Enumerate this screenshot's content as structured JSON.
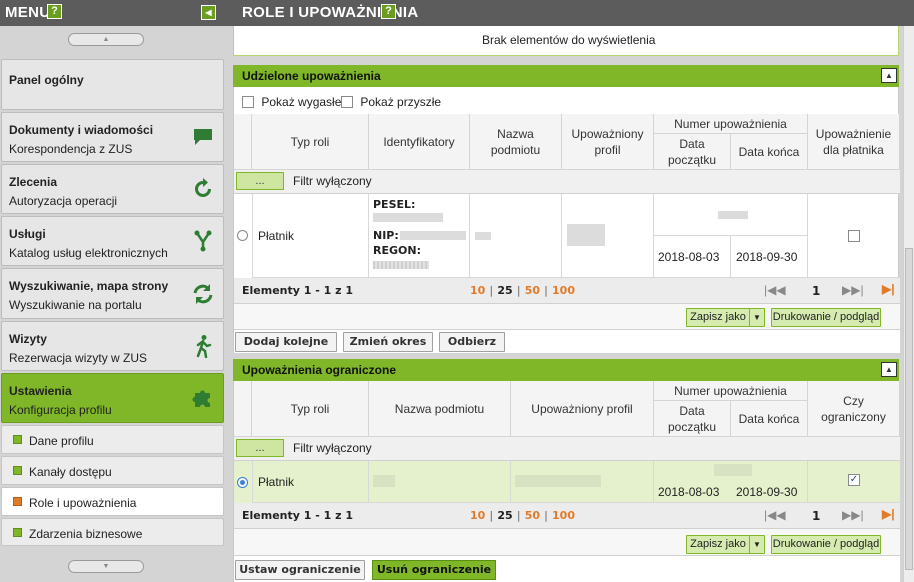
{
  "sidebar": {
    "menu_label": "MENU",
    "help_icon": "question-mark-icon",
    "collapse_icon": "arrow-left-icon",
    "scroll_up_glyph": "▲",
    "scroll_down_glyph": "▼",
    "items": [
      {
        "title": "Panel ogólny",
        "subtitle": "",
        "icon": ""
      },
      {
        "title": "Dokumenty i wiadomości",
        "subtitle": "Korespondencja z ZUS",
        "icon": "speech-bubble-icon"
      },
      {
        "title": "Zlecenia",
        "subtitle": "Autoryzacja operacji",
        "icon": "refresh-arrow-icon"
      },
      {
        "title": "Usługi",
        "subtitle": "Katalog usług elektronicznych",
        "icon": "network-nodes-icon"
      },
      {
        "title": "Wyszukiwanie, mapa strony",
        "subtitle": "Wyszukiwanie na portalu",
        "icon": "sync-arrows-icon"
      },
      {
        "title": "Wizyty",
        "subtitle": "Rezerwacja wizyty w ZUS",
        "icon": "walking-person-icon"
      },
      {
        "title": "Ustawienia",
        "subtitle": "Konfiguracja profilu",
        "icon": "puzzle-icon"
      }
    ],
    "sub_items": [
      {
        "label": "Dane profilu"
      },
      {
        "label": "Kanały dostępu"
      },
      {
        "label": "Role i upoważnienia"
      },
      {
        "label": "Zdarzenia biznesowe"
      }
    ]
  },
  "main": {
    "title": "ROLE I UPOWAŻNIENIA",
    "empty_message": "Brak elementów do wyświetlenia",
    "granted": {
      "title": "Udzielone upoważnienia",
      "toggle_glyph": "▲",
      "show_expired": "Pokaż wygasłe",
      "show_future": "Pokaż przyszłe",
      "headers": {
        "role_type": "Typ roli",
        "identifiers": "Identyfikatory",
        "entity_name": "Nazwa podmiotu",
        "authorized_profile": "Upoważniony profil",
        "number": "Numer upoważnienia",
        "start_date": "Data początku",
        "end_date": "Data końca",
        "payer_auth": "Upoważnienie dla płatnika"
      },
      "filter_button": "...",
      "filter_label": "Filtr wyłączony",
      "row": {
        "role": "Płatnik",
        "pesel_label": "PESEL:",
        "nip_label": "NIP:",
        "regon_label": "REGON:",
        "start": "2018-08-03",
        "end": "2018-09-30"
      },
      "pager": {
        "count": "Elementy 1 - 1 z 1",
        "sizes": [
          "10",
          "25",
          "50",
          "100"
        ],
        "page": "1"
      },
      "save_as": "Zapisz jako",
      "print": "Drukowanie / podgląd",
      "actions": {
        "add": "Dodaj kolejne",
        "change": "Zmień okres",
        "revoke": "Odbierz"
      }
    },
    "limited": {
      "title": "Upoważnienia ograniczone",
      "toggle_glyph": "▲",
      "headers": {
        "role_type": "Typ roli",
        "entity_name": "Nazwa podmiotu",
        "authorized_profile": "Upoważniony profil",
        "number": "Numer upoważnienia",
        "start_date": "Data początku",
        "end_date": "Data końca",
        "is_limited": "Czy ograniczony"
      },
      "filter_button": "...",
      "filter_label": "Filtr wyłączony",
      "row": {
        "role": "Płatnik",
        "start": "2018-08-03",
        "end": "2018-09-30",
        "limited_checked": true
      },
      "pager": {
        "count": "Elementy 1 - 1 z 1",
        "sizes": [
          "10",
          "25",
          "50",
          "100"
        ],
        "page": "1"
      },
      "save_as": "Zapisz jako",
      "print": "Drukowanie / podgląd",
      "actions": {
        "set_limit": "Ustaw ograniczenie",
        "remove_limit": "Usuń ograniczenie"
      }
    },
    "pager_glyphs": {
      "first": "|◀◀",
      "last": "▶▶|",
      "end": "▶|"
    }
  }
}
